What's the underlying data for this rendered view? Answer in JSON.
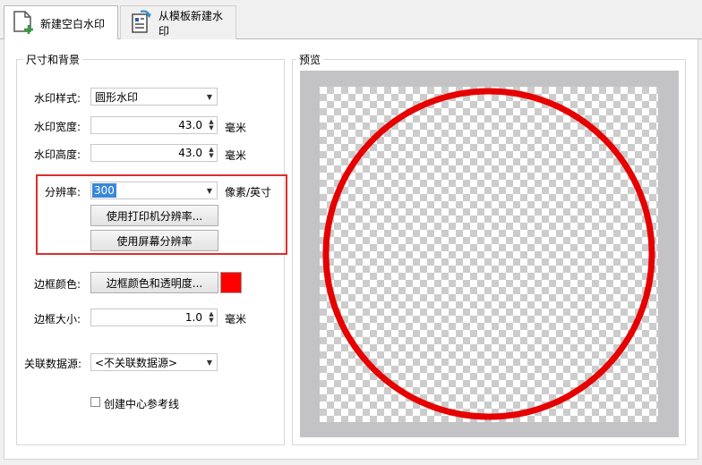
{
  "tabs": [
    {
      "label": "新建空白水印",
      "icon": "new-document-icon",
      "active": true
    },
    {
      "label": "从模板新建水印",
      "icon": "template-document-icon",
      "active": false
    }
  ],
  "size_group": {
    "title": "尺寸和背景",
    "style": {
      "label": "水印样式:",
      "value": "圆形水印"
    },
    "width": {
      "label": "水印宽度:",
      "value": "43.0",
      "unit": "毫米"
    },
    "height": {
      "label": "水印高度:",
      "value": "43.0",
      "unit": "毫米"
    },
    "resolution": {
      "label": "分辨率:",
      "value": "300",
      "unit": "像素/英寸"
    },
    "printer_button": "使用打印机分辨率...",
    "screen_button": "使用屏幕分辨率",
    "border_color": {
      "label": "边框颜色:",
      "button": "边框颜色和透明度...",
      "swatch": "#ff0000"
    },
    "border_size": {
      "label": "边框大小:",
      "value": "1.0",
      "unit": "毫米"
    },
    "datasource": {
      "label": "关联数据源:",
      "value": "<不关联数据源>"
    },
    "center_line": {
      "label": "创建中心参考线",
      "checked": false
    }
  },
  "preview": {
    "title": "预览",
    "circle_color": "#e60000"
  },
  "colors": {
    "highlight": "#d9302b",
    "accent": "#1a6fc2"
  }
}
